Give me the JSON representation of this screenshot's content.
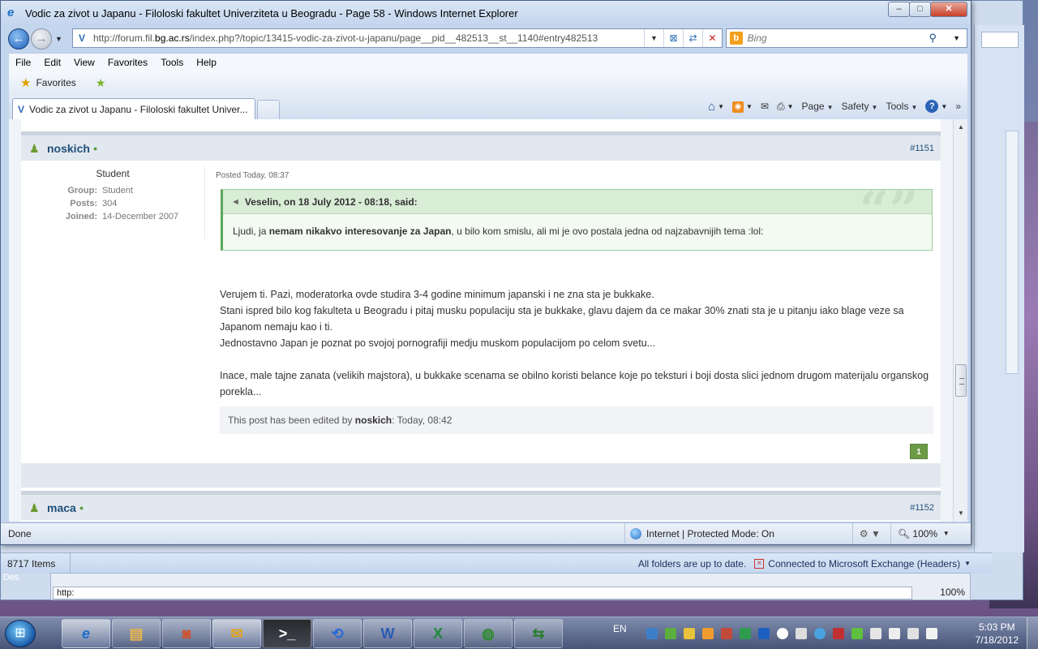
{
  "window": {
    "title": "Vodic za zivot u Japanu - Filoloski fakultet Univerziteta u Beogradu - Page 58 - Windows Internet Explorer",
    "min": "–",
    "max": "□",
    "close": "✕"
  },
  "address": {
    "url_prefix": "http://forum.fil.",
    "url_domain": "bg.ac.rs",
    "url_suffix": "/index.php?/topic/13415-vodic-za-zivot-u-japanu/page__pid__482513__st__1140#entry482513"
  },
  "search": {
    "placeholder": "Bing"
  },
  "menu": [
    "File",
    "Edit",
    "View",
    "Favorites",
    "Tools",
    "Help"
  ],
  "favorites": {
    "label": "Favorites"
  },
  "tab": {
    "label": "Vodic za zivot u Japanu - Filoloski fakultet Univer..."
  },
  "command_bar": {
    "page": "Page",
    "safety": "Safety",
    "tools": "Tools"
  },
  "post": {
    "author": "noskich",
    "number": "#1151",
    "member_title": "Student",
    "group_label": "Group:",
    "group": "Student",
    "posts_label": "Posts:",
    "posts": "304",
    "joined_label": "Joined:",
    "joined": "14-December 2007",
    "posted": "Posted Today, 08:37",
    "quote_header": "Veselin, on 18 July 2012 - 08:18, said:",
    "quote_pre": "Ljudi, ja ",
    "quote_bold": "nemam nikakvo interesovanje za Japan",
    "quote_post": ", u bilo kom smislu, ali mi je ovo postala jedna od najzabavnijih tema :lol:",
    "body_p1_l1": "Verujem ti. Pazi, moderatorka ovde studira 3-4 godine minimum japanski i ne zna sta je bukkake.",
    "body_p1_l2": "Stani ispred bilo kog fakulteta u Beogradu i pitaj musku populaciju sta je bukkake, glavu dajem da ce makar 30% znati sta je u pitanju iako blage veze sa Japanom nemaju kao i ti.",
    "body_p1_l3": "Jednostavno Japan je poznat po svojoj pornografiji medju muskom populacijom po celom svetu...",
    "body_p2": "Inace, male tajne zanata (velikih majstora), u bukkake scenama se obilno koristi belance koje po teksturi i boji dosta slici jednom drugom materijalu organskog porekla...",
    "edited_pre": "This post has been edited by ",
    "edited_by": "noskich",
    "edited_post": ": Today, 08:42",
    "reputation": "1"
  },
  "next_post": {
    "author": "maca",
    "number": "#1152"
  },
  "statusbar": {
    "done": "Done",
    "zone": "Internet | Protected Mode: On",
    "zoom": "100%"
  },
  "outlook": {
    "items": "8717 Items",
    "sync": "All folders are up to date.",
    "connection": "Connected to Microsoft Exchange (Headers)"
  },
  "background_ie": {
    "url_prefix": "http:",
    "zoom": "100%"
  },
  "taskbar": {
    "lang": "EN",
    "time": "5:03 PM",
    "date": "7/18/2012"
  },
  "colors": {
    "accent": "#1f4f7a",
    "quote_border": "#5aa85a",
    "rep": "#6d9a46"
  }
}
